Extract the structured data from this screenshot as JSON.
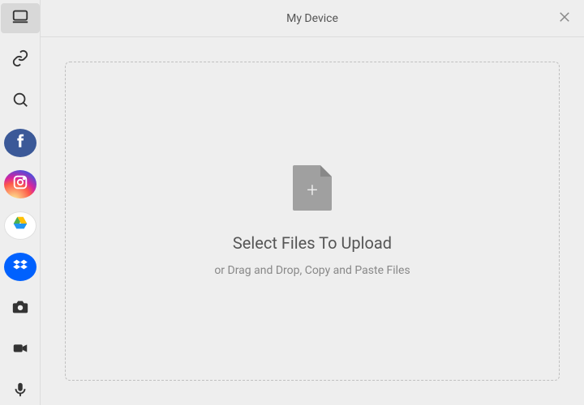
{
  "header": {
    "title": "My Device"
  },
  "dropzone": {
    "title": "Select Files To Upload",
    "subtitle": "or Drag and Drop, Copy and Paste Files",
    "plus": "+"
  },
  "sidebar": {
    "items": [
      {
        "name": "my-device"
      },
      {
        "name": "link"
      },
      {
        "name": "search"
      },
      {
        "name": "facebook"
      },
      {
        "name": "instagram"
      },
      {
        "name": "google-drive"
      },
      {
        "name": "dropbox"
      },
      {
        "name": "camera"
      },
      {
        "name": "video"
      },
      {
        "name": "microphone"
      }
    ]
  }
}
